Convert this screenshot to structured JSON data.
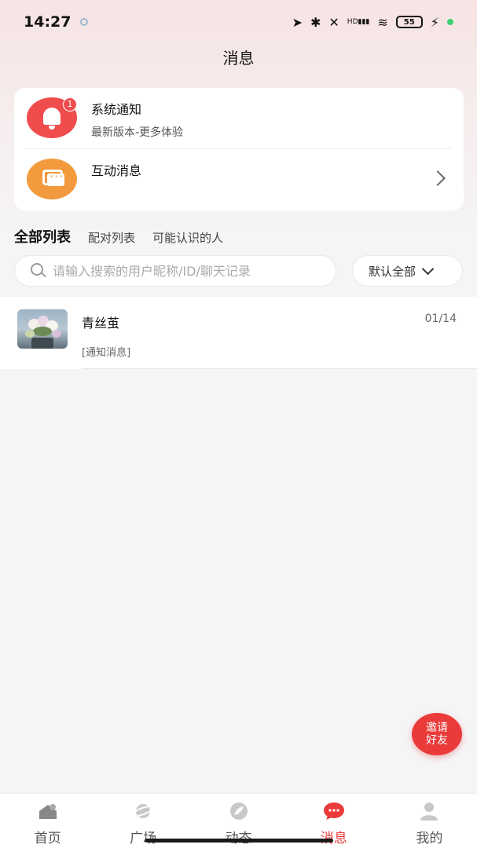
{
  "status_bar": {
    "time": "14:27",
    "network": "HD",
    "battery": "55"
  },
  "header": {
    "title": "消息"
  },
  "notifications": [
    {
      "title": "系统通知",
      "subtitle": "最新版本-更多体验",
      "badge": "1",
      "icon": "bell-icon",
      "color": "#ef4d4d"
    },
    {
      "title": "互动消息",
      "icon": "chat-icon",
      "color": "#f29a3d"
    }
  ],
  "tabs": [
    {
      "label": "全部列表"
    },
    {
      "label": "配对列表"
    },
    {
      "label": "可能认识的人"
    }
  ],
  "search": {
    "placeholder": "请输入搜索的用户昵称/ID/聊天记录"
  },
  "filter": {
    "label": "默认全部"
  },
  "conversations": [
    {
      "name": "青丝茧",
      "date": "01/14",
      "preview": "[通知消息]"
    }
  ],
  "invite_button": {
    "label": "邀请好友"
  },
  "bottom_nav": [
    {
      "label": "首页",
      "icon": "home-icon"
    },
    {
      "label": "广场",
      "icon": "planet-icon"
    },
    {
      "label": "动态",
      "icon": "moments-icon"
    },
    {
      "label": "消息",
      "icon": "message-icon",
      "active": true
    },
    {
      "label": "我的",
      "icon": "profile-icon"
    }
  ],
  "colors": {
    "accent": "#ea3a3a",
    "background": "#f5f5f7"
  }
}
